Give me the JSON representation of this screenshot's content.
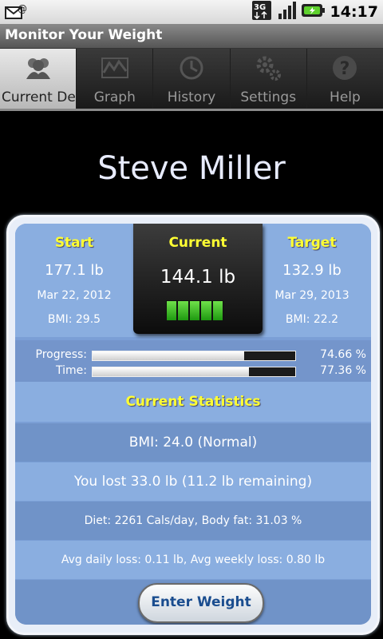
{
  "status_bar": {
    "time": "14:17",
    "network": "3G"
  },
  "app": {
    "title": "Monitor Your Weight"
  },
  "tabs": [
    {
      "label": "Current Deta",
      "icon": "users-icon",
      "active": true
    },
    {
      "label": "Graph",
      "icon": "graph-icon",
      "active": false
    },
    {
      "label": "History",
      "icon": "clock-icon",
      "active": false
    },
    {
      "label": "Settings",
      "icon": "gears-icon",
      "active": false
    },
    {
      "label": "Help",
      "icon": "help-icon",
      "active": false
    }
  ],
  "user": {
    "name": "Steve Miller"
  },
  "start": {
    "header": "Start",
    "weight": "177.1 lb",
    "date": "Mar 22, 2012",
    "bmi": "BMI: 29.5"
  },
  "current": {
    "header": "Current",
    "weight": "144.1 lb",
    "meter_segments": 5
  },
  "target": {
    "header": "Target",
    "weight": "132.9 lb",
    "date": "Mar 29, 2013",
    "bmi": "BMI: 22.2"
  },
  "progress": {
    "progress_label": "Progress:",
    "progress_pct": "74.66 %",
    "progress_value": 74.66,
    "time_label": "Time:",
    "time_pct": "77.36 %",
    "time_value": 77.36
  },
  "stats": {
    "header": "Current Statistics",
    "bmi": "BMI: 24.0 (Normal)",
    "lost": "You lost 33.0 lb (11.2 lb remaining)",
    "diet": "Diet: 2261 Cals/day, Body fat: 31.03 %",
    "avg": "Avg daily loss: 0.11 lb, Avg weekly loss: 0.80 lb"
  },
  "actions": {
    "enter_weight": "Enter Weight"
  },
  "colors": {
    "accent_yellow": "#ffff33",
    "panel_blue": "#8aaee0",
    "button_text": "#1a4d8f"
  }
}
